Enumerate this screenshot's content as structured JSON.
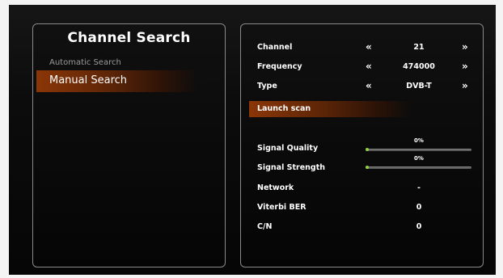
{
  "left_panel": {
    "title": "Channel Search",
    "items": [
      {
        "label": "Automatic Search",
        "selected": false
      },
      {
        "label": "Manual Search",
        "selected": true
      }
    ]
  },
  "right_panel": {
    "channel": {
      "label": "Channel",
      "value": "21"
    },
    "frequency": {
      "label": "Frequency",
      "value": "474000"
    },
    "type": {
      "label": "Type",
      "value": "DVB-T"
    },
    "arrow_left": "«",
    "arrow_right": "»",
    "launch_label": "Launch scan",
    "signal_quality": {
      "label": "Signal Quality",
      "percent_text": "0%",
      "value": 0
    },
    "signal_strength": {
      "label": "Signal Strength",
      "percent_text": "0%",
      "value": 0
    },
    "network": {
      "label": "Network",
      "value": "-"
    },
    "viterbi": {
      "label": "Viterbi BER",
      "value": "0"
    },
    "cn": {
      "label": "C/N",
      "value": "0"
    }
  },
  "colors": {
    "highlight": "#8a3607",
    "bar_fill": "#6dbf2a"
  }
}
